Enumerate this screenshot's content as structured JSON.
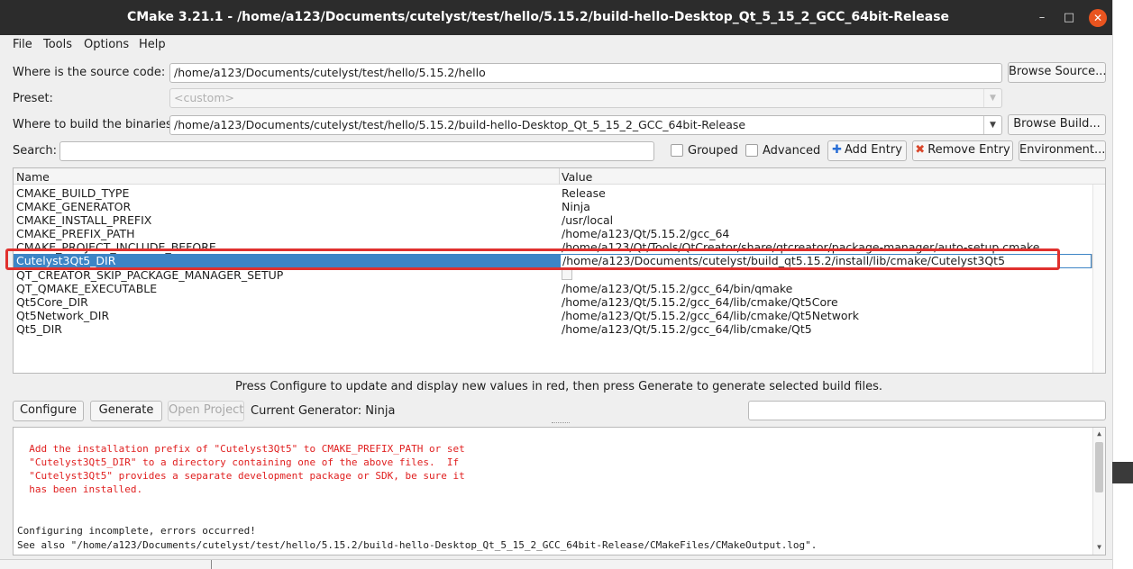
{
  "window": {
    "title": "CMake 3.21.1 - /home/a123/Documents/cutelyst/test/hello/5.15.2/build-hello-Desktop_Qt_5_15_2_GCC_64bit-Release",
    "minimize_icon": "minimize-icon",
    "maximize_icon": "maximize-icon",
    "close_icon": "close-icon",
    "close_color": "#e9541f"
  },
  "menu": {
    "file": "File",
    "tools": "Tools",
    "options": "Options",
    "help": "Help"
  },
  "source": {
    "label": "Where is the source code:",
    "value": "/home/a123/Documents/cutelyst/test/hello/5.15.2/hello",
    "browse_label": "Browse Source..."
  },
  "preset": {
    "label": "Preset:",
    "value": "<custom>"
  },
  "build": {
    "label": "Where to build the binaries:",
    "value": "/home/a123/Documents/cutelyst/test/hello/5.15.2/build-hello-Desktop_Qt_5_15_2_GCC_64bit-Release",
    "browse_label": "Browse Build..."
  },
  "search": {
    "label": "Search:",
    "value": ""
  },
  "filters": {
    "grouped_label": "Grouped",
    "grouped_checked": false,
    "advanced_label": "Advanced",
    "advanced_checked": false
  },
  "entry_buttons": {
    "add_label": "Add Entry",
    "add_icon": "plus-icon",
    "remove_label": "Remove Entry",
    "remove_icon": "x-icon",
    "environment_label": "Environment..."
  },
  "cache_table": {
    "columns": [
      "Name",
      "Value"
    ],
    "rows": [
      {
        "name": "CMAKE_BUILD_TYPE",
        "value": "Release"
      },
      {
        "name": "CMAKE_GENERATOR",
        "value": "Ninja"
      },
      {
        "name": "CMAKE_INSTALL_PREFIX",
        "value": "/usr/local"
      },
      {
        "name": "CMAKE_PREFIX_PATH",
        "value": "/home/a123/Qt/5.15.2/gcc_64"
      },
      {
        "name": "CMAKE_PROJECT_INCLUDE_BEFORE",
        "value": "/home/a123/Qt/Tools/QtCreator/share/qtcreator/package-manager/auto-setup.cmake"
      },
      {
        "name": "Cutelyst3Qt5_DIR",
        "value": "/home/a123/Documents/cutelyst/build_qt5.15.2/install/lib/cmake/Cutelyst3Qt5",
        "selected": true,
        "editing": true
      },
      {
        "name": "QT_CREATOR_SKIP_PACKAGE_MANAGER_SETUP",
        "value": "",
        "bool": true
      },
      {
        "name": "QT_QMAKE_EXECUTABLE",
        "value": "/home/a123/Qt/5.15.2/gcc_64/bin/qmake"
      },
      {
        "name": "Qt5Core_DIR",
        "value": "/home/a123/Qt/5.15.2/gcc_64/lib/cmake/Qt5Core"
      },
      {
        "name": "Qt5Network_DIR",
        "value": "/home/a123/Qt/5.15.2/gcc_64/lib/cmake/Qt5Network"
      },
      {
        "name": "Qt5_DIR",
        "value": "/home/a123/Qt/5.15.2/gcc_64/lib/cmake/Qt5"
      }
    ],
    "browse_dots": "...",
    "highlight_color": "#e0312e",
    "selection_color": "#3d85c6"
  },
  "hint": "Press Configure to update and display new values in red, then press Generate to generate selected build files.",
  "actions": {
    "configure_label": "Configure",
    "generate_label": "Generate",
    "open_project_label": "Open Project",
    "current_generator": "Current Generator: Ninja"
  },
  "output": {
    "error_color": "#e02020",
    "lines": [
      {
        "text": "  Add the installation prefix of \"Cutelyst3Qt5\" to CMAKE_PREFIX_PATH or set",
        "error": true
      },
      {
        "text": "  \"Cutelyst3Qt5_DIR\" to a directory containing one of the above files.  If",
        "error": true
      },
      {
        "text": "  \"Cutelyst3Qt5\" provides a separate development package or SDK, be sure it",
        "error": true
      },
      {
        "text": "  has been installed.",
        "error": true
      },
      {
        "text": "",
        "error": false
      },
      {
        "text": "",
        "error": false
      },
      {
        "text": "Configuring incomplete, errors occurred!",
        "error": false
      },
      {
        "text": "See also \"/home/a123/Documents/cutelyst/test/hello/5.15.2/build-hello-Desktop_Qt_5_15_2_GCC_64bit-Release/CMakeFiles/CMakeOutput.log\".",
        "error": false
      }
    ]
  }
}
